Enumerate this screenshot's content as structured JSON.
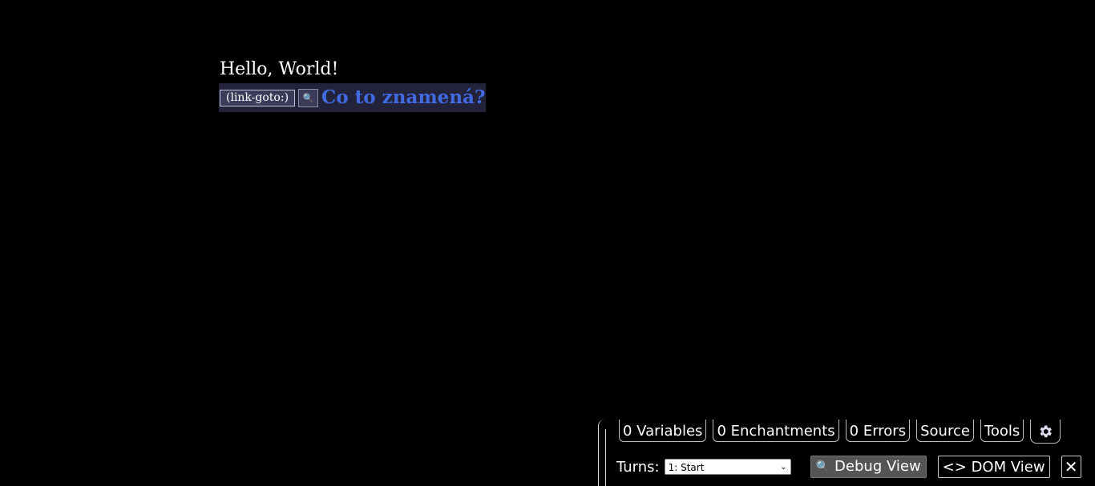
{
  "story": {
    "greeting": "Hello, World!",
    "macro_label": "(link-goto:)",
    "link_text": "Co to znamená?"
  },
  "debug": {
    "tabs": {
      "variables": "0 Variables",
      "enchantments": "0 Enchantments",
      "errors": "0 Errors",
      "source": "Source",
      "tools": "Tools"
    },
    "turns_label": "Turns:",
    "turns_selected": "1: Start",
    "debug_view_label": "Debug View",
    "dom_view_label": "<> DOM View",
    "close_label": "✕"
  },
  "colors": {
    "background": "#000000",
    "link": "#4169e1",
    "macro_bg": "#22223a"
  }
}
